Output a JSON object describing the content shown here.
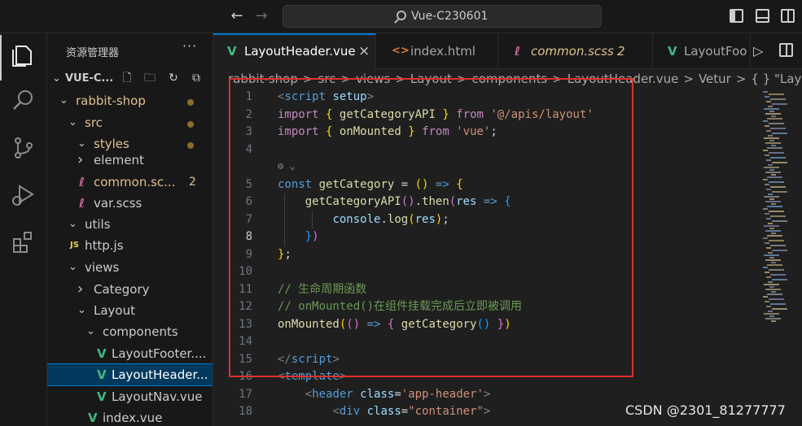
{
  "titlebar": {
    "search_text": "Vue-C230601",
    "back_icon": "arrow-left-icon",
    "forward_icon": "arrow-right-icon"
  },
  "sidebar": {
    "title": "资源管理器",
    "more": "···",
    "root": "VUE-C...",
    "tree": [
      {
        "label": "rabbit-shop",
        "kind": "folder-open",
        "color": "#e2c08d",
        "dot": true
      },
      {
        "label": "src",
        "kind": "folder-open",
        "color": "#e2c08d",
        "dot": true
      },
      {
        "label": "styles",
        "kind": "folder-open",
        "color": "#e2c08d",
        "dot": true
      },
      {
        "label": "element",
        "kind": "folder-closed",
        "color": "#cccccc"
      },
      {
        "label": "common.sc...",
        "kind": "scss",
        "color": "#e2c08d",
        "badge": "2"
      },
      {
        "label": "var.scss",
        "kind": "scss",
        "color": "#cccccc"
      },
      {
        "label": "utils",
        "kind": "folder-open",
        "color": "#cccccc"
      },
      {
        "label": "http.js",
        "kind": "js",
        "color": "#cccccc"
      },
      {
        "label": "views",
        "kind": "folder-open",
        "color": "#cccccc"
      },
      {
        "label": "Category",
        "kind": "folder-closed",
        "color": "#cccccc"
      },
      {
        "label": "Layout",
        "kind": "folder-open",
        "color": "#cccccc"
      },
      {
        "label": "components",
        "kind": "folder-open",
        "color": "#cccccc"
      },
      {
        "label": "LayoutFooter....",
        "kind": "vue",
        "color": "#cccccc"
      },
      {
        "label": "LayoutHeader...",
        "kind": "vue",
        "color": "#cccccc",
        "selected": true
      },
      {
        "label": "LayoutNav.vue",
        "kind": "vue",
        "color": "#cccccc"
      },
      {
        "label": "index.vue",
        "kind": "vue",
        "color": "#cccccc"
      }
    ]
  },
  "tabs": [
    {
      "label": "LayoutHeader.vue",
      "icon": "vue-icon",
      "active": true,
      "close": "×"
    },
    {
      "label": "index.html",
      "icon": "html-icon"
    },
    {
      "label": "common.scss",
      "icon": "scss-icon",
      "badge": "2",
      "modified_color": "#e2c08d"
    },
    {
      "label": "LayoutFoo",
      "icon": "vue-icon"
    }
  ],
  "breadcrumb": [
    "rabbit-shop",
    ">",
    "src",
    ">",
    "views",
    ">",
    "Layout",
    ">",
    "components",
    ">",
    "LayoutHeader.vue",
    ">",
    "Vetur",
    ">",
    "{ } \"LayoutH"
  ],
  "editor": {
    "current_line": 8,
    "line_numbers": [
      "1",
      "2",
      "3",
      "4",
      "5",
      "6",
      "7",
      "8",
      "9",
      "10",
      "11",
      "12",
      "13",
      "14",
      "15",
      "16",
      "17",
      "18"
    ],
    "lines": [
      [
        [
          "t-pun",
          "<"
        ],
        [
          "t-tag",
          "script"
        ],
        [
          "t-def",
          " "
        ],
        [
          "t-attr",
          "setup"
        ],
        [
          "t-pun",
          ">"
        ]
      ],
      [
        [
          "t-kw",
          "import"
        ],
        [
          "t-def",
          " "
        ],
        [
          "t-br",
          "{"
        ],
        [
          "t-def",
          " "
        ],
        [
          "t-fn",
          "getCategoryAPI"
        ],
        [
          "t-def",
          " "
        ],
        [
          "t-br",
          "}"
        ],
        [
          "t-def",
          " "
        ],
        [
          "t-kw",
          "from"
        ],
        [
          "t-def",
          " "
        ],
        [
          "t-str",
          "'@/apis/layout'"
        ]
      ],
      [
        [
          "t-kw",
          "import"
        ],
        [
          "t-def",
          " "
        ],
        [
          "t-br",
          "{"
        ],
        [
          "t-def",
          " "
        ],
        [
          "t-fn",
          "onMounted"
        ],
        [
          "t-def",
          " "
        ],
        [
          "t-br",
          "}"
        ],
        [
          "t-def",
          " "
        ],
        [
          "t-kw",
          "from"
        ],
        [
          "t-def",
          " "
        ],
        [
          "t-str",
          "'vue'"
        ],
        [
          "t-def",
          ";"
        ]
      ],
      [],
      [
        [
          "t-dec",
          "const"
        ],
        [
          "t-def",
          " "
        ],
        [
          "t-fn",
          "getCategory"
        ],
        [
          "t-def",
          " = "
        ],
        [
          "t-br",
          "()"
        ],
        [
          "t-def",
          " "
        ],
        [
          "t-dec",
          "=>"
        ],
        [
          "t-def",
          " "
        ],
        [
          "t-br",
          "{"
        ]
      ],
      [
        [
          "t-def",
          "    "
        ],
        [
          "t-fn",
          "getCategoryAPI"
        ],
        [
          "t-br2",
          "()"
        ],
        [
          "t-def",
          "."
        ],
        [
          "t-fn",
          "then"
        ],
        [
          "t-br2",
          "("
        ],
        [
          "t-var",
          "res"
        ],
        [
          "t-def",
          " "
        ],
        [
          "t-dec",
          "=>"
        ],
        [
          "t-def",
          " "
        ],
        [
          "t-br3",
          "{"
        ]
      ],
      [
        [
          "t-def",
          "        "
        ],
        [
          "t-var",
          "console"
        ],
        [
          "t-def",
          "."
        ],
        [
          "t-fn",
          "log"
        ],
        [
          "t-br",
          "("
        ],
        [
          "t-var",
          "res"
        ],
        [
          "t-br",
          ")"
        ],
        [
          "t-def",
          ";"
        ]
      ],
      [
        [
          "t-def",
          "    "
        ],
        [
          "t-br3",
          "}"
        ],
        [
          "t-br2",
          ")"
        ]
      ],
      [
        [
          "t-br",
          "}"
        ],
        [
          "t-def",
          ";"
        ]
      ],
      [],
      [
        [
          "t-com",
          "// 生命周期函数"
        ]
      ],
      [
        [
          "t-com",
          "// onMounted()在组件挂载完成后立即被调用"
        ]
      ],
      [
        [
          "t-fn",
          "onMounted"
        ],
        [
          "t-br",
          "("
        ],
        [
          "t-br2",
          "()"
        ],
        [
          "t-def",
          " "
        ],
        [
          "t-dec",
          "=>"
        ],
        [
          "t-def",
          " "
        ],
        [
          "t-br2",
          "{"
        ],
        [
          "t-def",
          " "
        ],
        [
          "t-fn",
          "getCategory"
        ],
        [
          "t-br3",
          "()"
        ],
        [
          "t-def",
          " "
        ],
        [
          "t-br2",
          "}"
        ],
        [
          "t-br",
          ")"
        ]
      ],
      [],
      [
        [
          "t-pun",
          "</"
        ],
        [
          "t-tag",
          "script"
        ],
        [
          "t-pun",
          ">"
        ]
      ],
      [
        [
          "t-pun",
          "<"
        ],
        [
          "t-tag",
          "template"
        ],
        [
          "t-pun",
          ">"
        ]
      ],
      [
        [
          "t-def",
          "    "
        ],
        [
          "t-pun",
          "<"
        ],
        [
          "t-tag",
          "header"
        ],
        [
          "t-def",
          " "
        ],
        [
          "t-attr",
          "class"
        ],
        [
          "t-def",
          "="
        ],
        [
          "t-str",
          "'app-header'"
        ],
        [
          "t-pun",
          ">"
        ]
      ],
      [
        [
          "t-def",
          "        "
        ],
        [
          "t-pun",
          "<"
        ],
        [
          "t-tag",
          "div"
        ],
        [
          "t-def",
          " "
        ],
        [
          "t-attr",
          "class"
        ],
        [
          "t-def",
          "="
        ],
        [
          "t-str",
          "\"container\""
        ],
        [
          "t-pun",
          ">"
        ]
      ]
    ]
  },
  "watermark": "CSDN @2301_81277777"
}
